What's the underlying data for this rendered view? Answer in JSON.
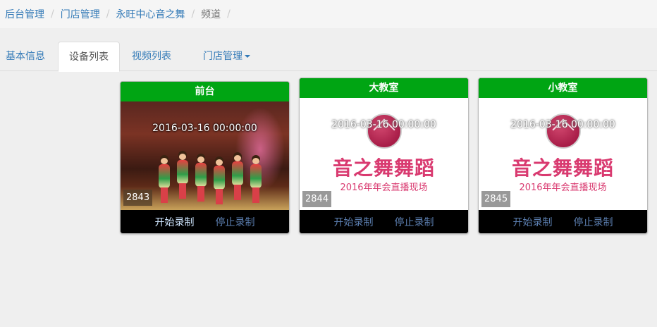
{
  "breadcrumb": [
    "后台管理",
    "门店管理",
    "永旺中心音之舞",
    "频道"
  ],
  "tabs": [
    {
      "label": "基本信息"
    },
    {
      "label": "设备列表"
    },
    {
      "label": "视频列表"
    },
    {
      "label": "门店管理"
    }
  ],
  "cards": [
    {
      "title": "前台",
      "timestamp": "2016-03-16 00:00:00",
      "device_id": "2843",
      "start": "开始录制",
      "stop": "停止录制"
    },
    {
      "title": "大教室",
      "timestamp": "2016-03-16 00:00:00",
      "device_id": "2844",
      "promo_title": "音之舞舞蹈",
      "promo_sub": "2016年年会直播现场",
      "start": "开始录制",
      "stop": "停止录制"
    },
    {
      "title": "小教室",
      "timestamp": "2016-03-16 00:00:00",
      "device_id": "2845",
      "promo_title": "音之舞舞蹈",
      "promo_sub": "2016年年会直播现场",
      "start": "开始录制",
      "stop": "停止录制"
    }
  ],
  "colors": {
    "accent_green": "#00a513",
    "link_blue": "#337ab7",
    "promo_pink": "#d93a70"
  },
  "icons": {
    "dropdown": "caret-down-icon",
    "logo": "dance-logo-icon"
  }
}
